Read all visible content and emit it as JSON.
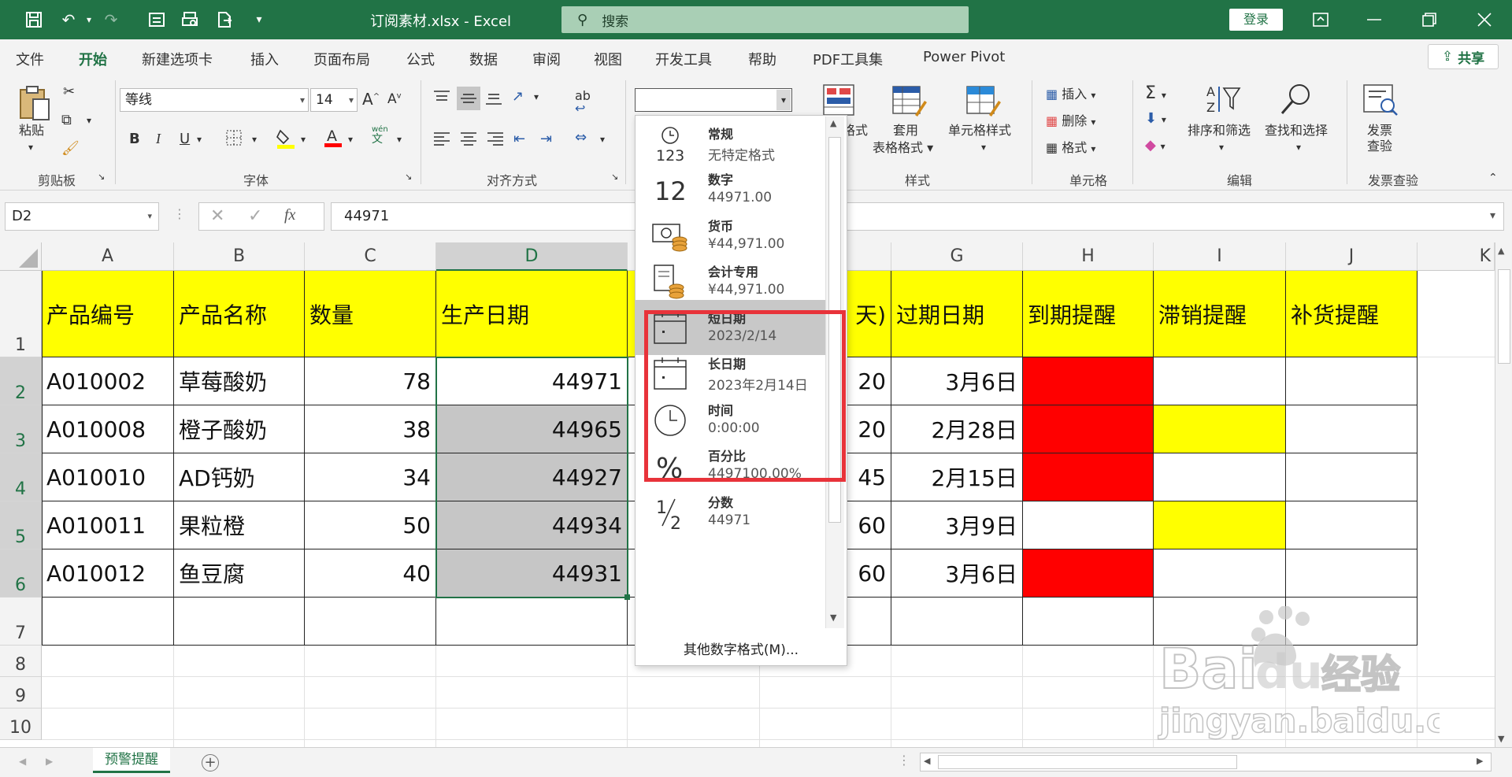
{
  "titlebar": {
    "doc_title": "订阅素材.xlsx  -  Excel",
    "search_placeholder": "搜索",
    "login_label": "登录"
  },
  "menu": {
    "tabs": [
      "文件",
      "开始",
      "新建选项卡",
      "插入",
      "页面布局",
      "公式",
      "数据",
      "审阅",
      "视图",
      "开发工具",
      "帮助",
      "PDF工具集",
      "Power Pivot"
    ],
    "active": "开始",
    "share_label": "共享"
  },
  "ribbon": {
    "clipboard": {
      "paste_label": "粘贴",
      "group_label": "剪贴板"
    },
    "font": {
      "font_name": "等线",
      "font_size": "14",
      "group_label": "字体",
      "bold": "B",
      "italic": "I",
      "underline": "U",
      "wen_label": "wén",
      "wen_char": "文"
    },
    "alignment": {
      "group_label": "对齐方式",
      "wrap_label": "ab"
    },
    "number": {
      "format_value": ""
    },
    "styles": {
      "cond_format_label": "格式",
      "table_format_label_1": "套用",
      "table_format_label_2": "表格格式",
      "cell_styles_label": "单元格样式",
      "group_label": "样式"
    },
    "cells": {
      "insert_label": "插入",
      "delete_label": "删除",
      "format_label": "格式",
      "group_label": "单元格"
    },
    "editing": {
      "sort_label": "排序和筛选",
      "find_label": "查找和选择",
      "group_label": "编辑"
    },
    "invoice": {
      "label_1": "发票",
      "label_2": "查验",
      "group_label": "发票查验"
    }
  },
  "formula_bar": {
    "name_box": "D2",
    "formula_value": "44971"
  },
  "sheet": {
    "columns": [
      "A",
      "B",
      "C",
      "D",
      "",
      "",
      "G",
      "H",
      "I",
      "J",
      "K"
    ],
    "selected_column": "D",
    "rows": [
      "1",
      "2",
      "3",
      "4",
      "5",
      "6",
      "7",
      "8",
      "9",
      "10"
    ],
    "headers": [
      "产品编号",
      "产品名称",
      "数量",
      "生产日期",
      "天)",
      "过期日期",
      "到期提醒",
      "滞销提醒",
      "补货提醒"
    ],
    "data": [
      {
        "code": "A010002",
        "name": "草莓酸奶",
        "qty": "78",
        "date": "44971",
        "days": "20",
        "expire": "3月6日",
        "due": "red",
        "slow": "",
        "restock": ""
      },
      {
        "code": "A010008",
        "name": "橙子酸奶",
        "qty": "38",
        "date": "44965",
        "days": "20",
        "expire": "2月28日",
        "due": "red",
        "slow": "yellow",
        "restock": ""
      },
      {
        "code": "A010010",
        "name": "AD钙奶",
        "qty": "34",
        "date": "44927",
        "days": "45",
        "expire": "2月15日",
        "due": "red",
        "slow": "",
        "restock": ""
      },
      {
        "code": "A010011",
        "name": "果粒橙",
        "qty": "50",
        "date": "44934",
        "days": "60",
        "expire": "3月9日",
        "due": "",
        "slow": "yellow",
        "restock": ""
      },
      {
        "code": "A010012",
        "name": "鱼豆腐",
        "qty": "40",
        "date": "44931",
        "days": "60",
        "expire": "3月6日",
        "due": "red",
        "slow": "",
        "restock": ""
      }
    ],
    "sheet_tab": "预警提醒"
  },
  "number_format_dropdown": {
    "items": [
      {
        "icon": "clock-123-icon",
        "name": "常规",
        "sample": "无特定格式"
      },
      {
        "icon": "number-12-icon",
        "name": "数字",
        "sample": "44971.00"
      },
      {
        "icon": "currency-icon",
        "name": "货币",
        "sample": "¥44,971.00"
      },
      {
        "icon": "accounting-icon",
        "name": "会计专用",
        "sample": "¥44,971.00"
      },
      {
        "icon": "calendar-icon",
        "name": "短日期",
        "sample": "2023/2/14"
      },
      {
        "icon": "calendar-icon",
        "name": "长日期",
        "sample": "2023年2月14日"
      },
      {
        "icon": "clock-icon",
        "name": "时间",
        "sample": "0:00:00"
      },
      {
        "icon": "percent-icon",
        "name": "百分比",
        "sample": "4497100.00%"
      },
      {
        "icon": "fraction-icon",
        "name": "分数",
        "sample": "44971"
      }
    ],
    "highlighted": "短日期",
    "more_label": "其他数字格式(M)..."
  },
  "colors": {
    "excel_green": "#217346",
    "header_yellow": "#ffff00",
    "alert_red": "#ff0000",
    "highlight_box": "#e8333a"
  },
  "watermark": {
    "line1": "Bai",
    "line1b": "du",
    "line1c": "经验",
    "line2": "jingyan.baidu.com"
  }
}
